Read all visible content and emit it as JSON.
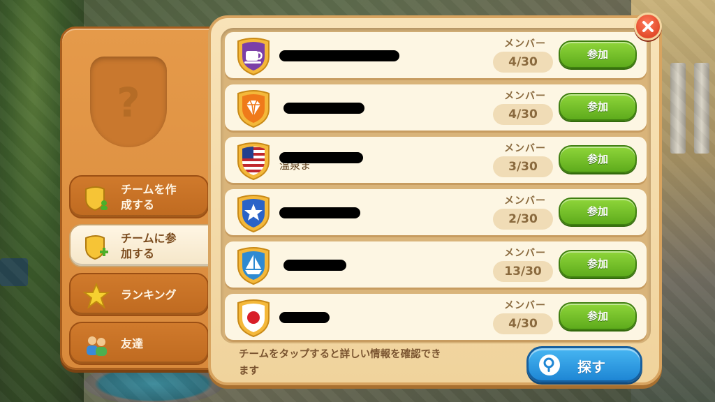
{
  "sidebar": {
    "items": [
      {
        "label": "チームを作成する",
        "line1": "チームを作",
        "line2": "成する",
        "icon": "shield-person-icon",
        "active": false
      },
      {
        "label": "チームに参加する",
        "line1": "チームに参",
        "line2": "加する",
        "icon": "shield-plus-icon",
        "active": true
      },
      {
        "label": "ランキング",
        "icon": "star-icon",
        "active": false
      },
      {
        "label": "友達",
        "icon": "friends-icon",
        "active": false
      }
    ]
  },
  "teams": [
    {
      "badge": "teacup-icon",
      "badge_color": "#7b3fa8",
      "member_label": "メンバー",
      "members": "4/30",
      "join": "参加"
    },
    {
      "badge": "diamond-icon",
      "badge_color": "#ef7a1a",
      "member_label": "メンバー",
      "members": "4/30",
      "join": "参加"
    },
    {
      "badge": "us-flag-icon",
      "badge_color": "#c0282e",
      "name_visible": "温泉ま",
      "member_label": "メンバー",
      "members": "3/30",
      "join": "参加"
    },
    {
      "badge": "star-icon",
      "badge_color": "#2a63c8",
      "member_label": "メンバー",
      "members": "2/30",
      "join": "参加"
    },
    {
      "badge": "sailboat-icon",
      "badge_color": "#2e8ad2",
      "member_label": "メンバー",
      "members": "13/30",
      "join": "参加"
    },
    {
      "badge": "japan-flag-icon",
      "badge_color": "#d81e2a",
      "member_label": "メンバー",
      "members": "4/30",
      "join": "参加"
    }
  ],
  "footer": {
    "hint": "チームをタップすると詳しい情報を確認できます",
    "hint_line1": "チームをタップすると詳しい情報を確認でき",
    "hint_line2": "ます",
    "search_label": "探す"
  },
  "colors": {
    "panel_orange": "#e59a4a",
    "join_green": "#5eab1c",
    "search_blue": "#1e86d4",
    "close_red": "#e24a2a"
  }
}
